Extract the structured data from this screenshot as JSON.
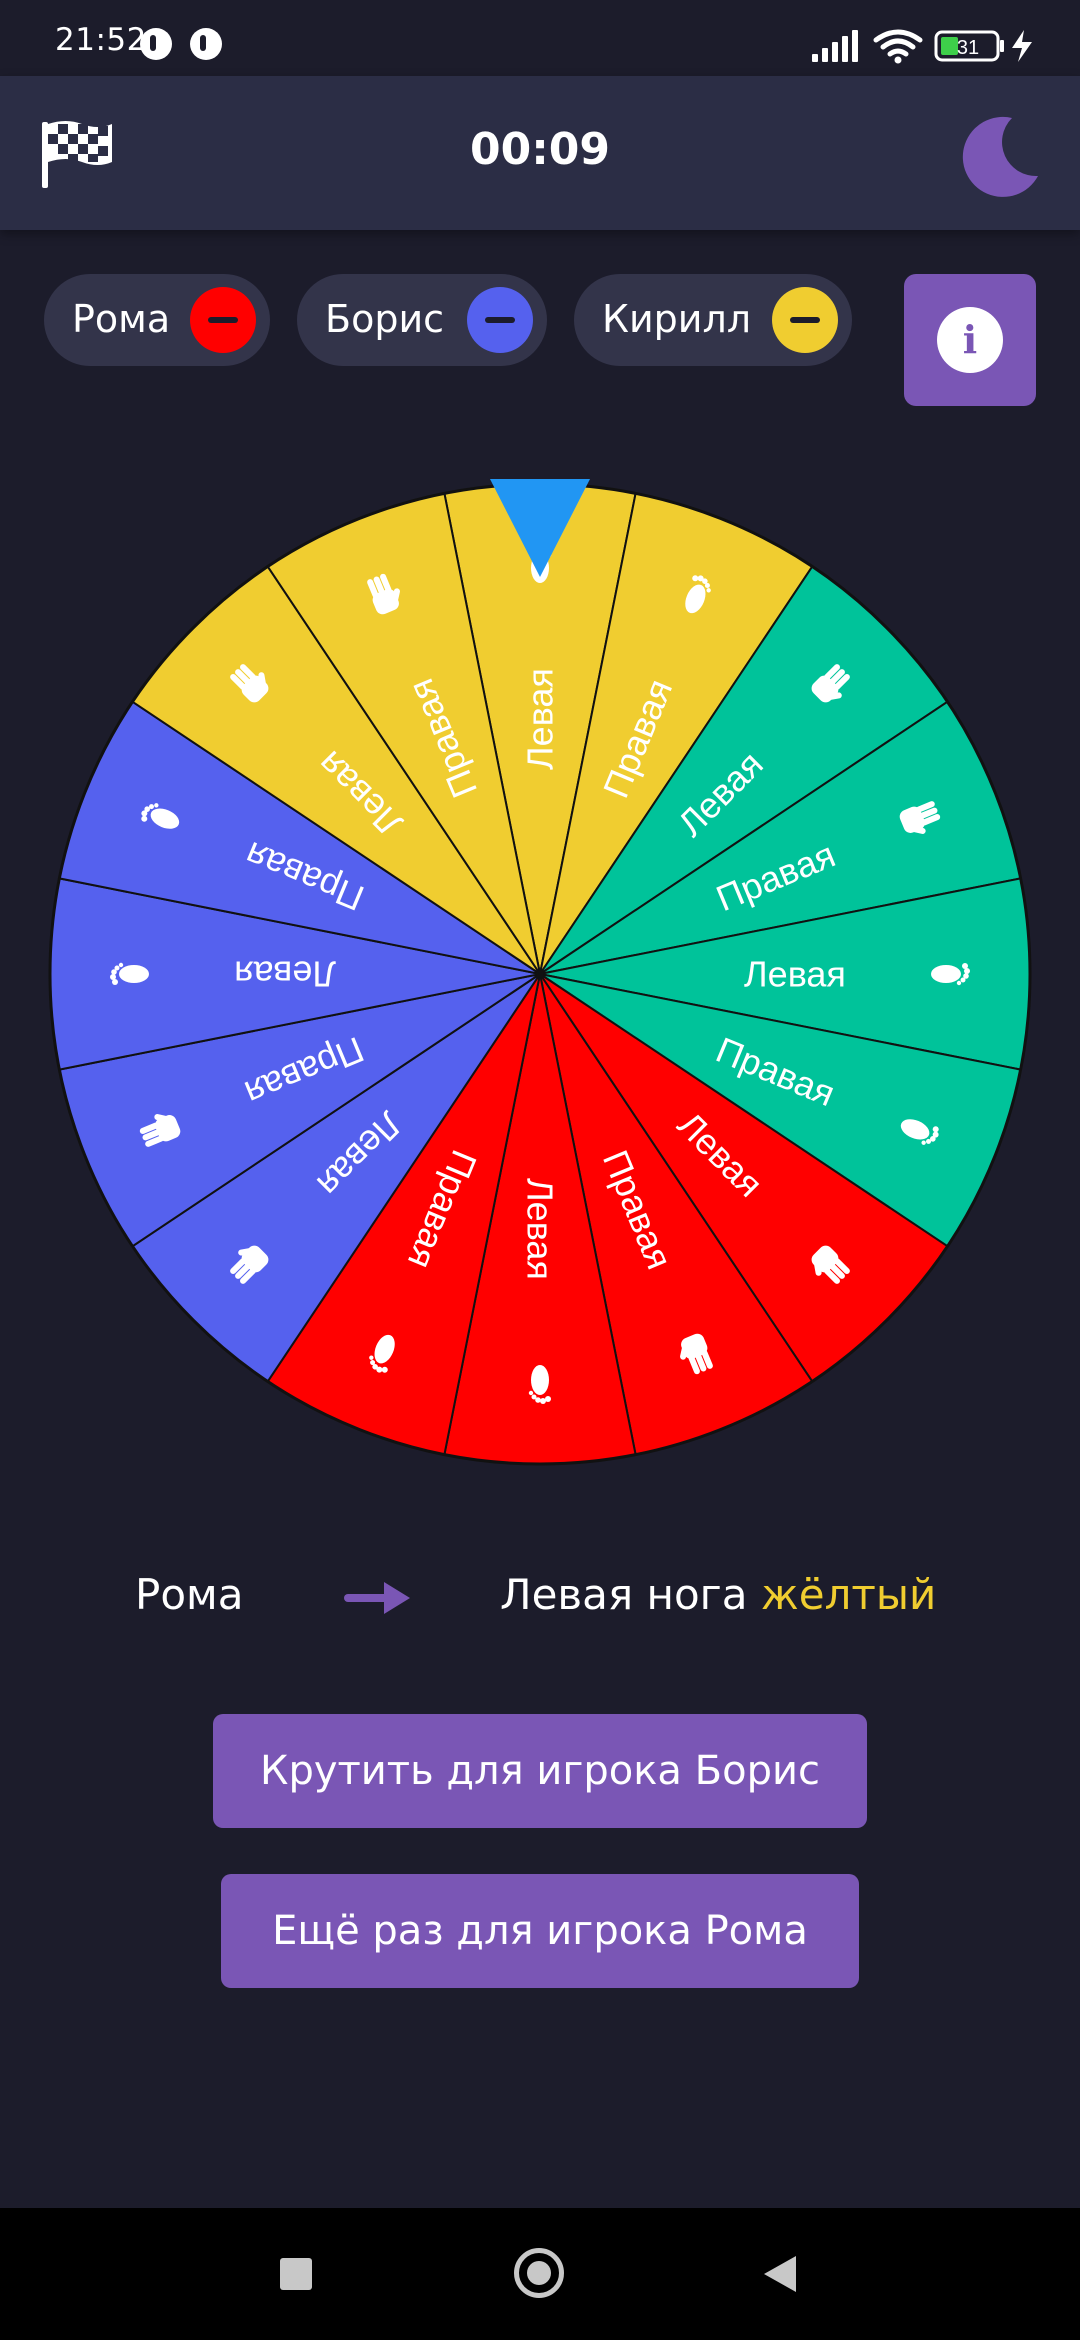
{
  "status_bar": {
    "time": "21:52",
    "battery_level": "31",
    "icons": [
      "app-notification-icon",
      "app-notification-icon",
      "signal-icon",
      "wifi-icon",
      "battery-icon",
      "charging-icon"
    ]
  },
  "app_bar": {
    "timer": "00:09",
    "left_icon": "checkered-flag-icon",
    "right_icon": "moon-icon"
  },
  "players": [
    {
      "name": "Рома",
      "color": "#ff0000"
    },
    {
      "name": "Борис",
      "color": "#5561ee"
    },
    {
      "name": "Кирилл",
      "color": "#f0cd30"
    }
  ],
  "info_button": {
    "icon": "info-icon",
    "glyph": "i"
  },
  "wheel": {
    "pointer_color": "#2196f3",
    "segments": [
      {
        "label": "Левая",
        "color": "yellow",
        "icon": "foot"
      },
      {
        "label": "Правая",
        "color": "yellow",
        "icon": "foot"
      },
      {
        "label": "Левая",
        "color": "green",
        "icon": "hand"
      },
      {
        "label": "Правая",
        "color": "green",
        "icon": "hand"
      },
      {
        "label": "Левая",
        "color": "green",
        "icon": "foot"
      },
      {
        "label": "Правая",
        "color": "green",
        "icon": "foot"
      },
      {
        "label": "Левая",
        "color": "red",
        "icon": "hand"
      },
      {
        "label": "Правая",
        "color": "red",
        "icon": "hand"
      },
      {
        "label": "Левая",
        "color": "red",
        "icon": "foot"
      },
      {
        "label": "Правая",
        "color": "red",
        "icon": "foot"
      },
      {
        "label": "Левая",
        "color": "blue",
        "icon": "hand"
      },
      {
        "label": "Правая",
        "color": "blue",
        "icon": "hand"
      },
      {
        "label": "Левая",
        "color": "blue",
        "icon": "foot"
      },
      {
        "label": "Правая",
        "color": "blue",
        "icon": "foot"
      },
      {
        "label": "Левая",
        "color": "yellow",
        "icon": "hand"
      },
      {
        "label": "Правая",
        "color": "yellow",
        "icon": "hand"
      }
    ],
    "colors": {
      "yellow": "#f0cd30",
      "green": "#00c39a",
      "red": "#ff0000",
      "blue": "#5561ee"
    }
  },
  "result": {
    "player": "Рома",
    "limb": "Левая нога",
    "color_word": "жёлтый",
    "arrow_icon": "arrow-right-icon"
  },
  "buttons": {
    "spin_next": "Крутить для игрока Борис",
    "spin_again": "Ещё раз для игрока Рома"
  },
  "nav_bar": {
    "icons": [
      "recents-square-icon",
      "home-circle-icon",
      "back-triangle-icon"
    ]
  }
}
